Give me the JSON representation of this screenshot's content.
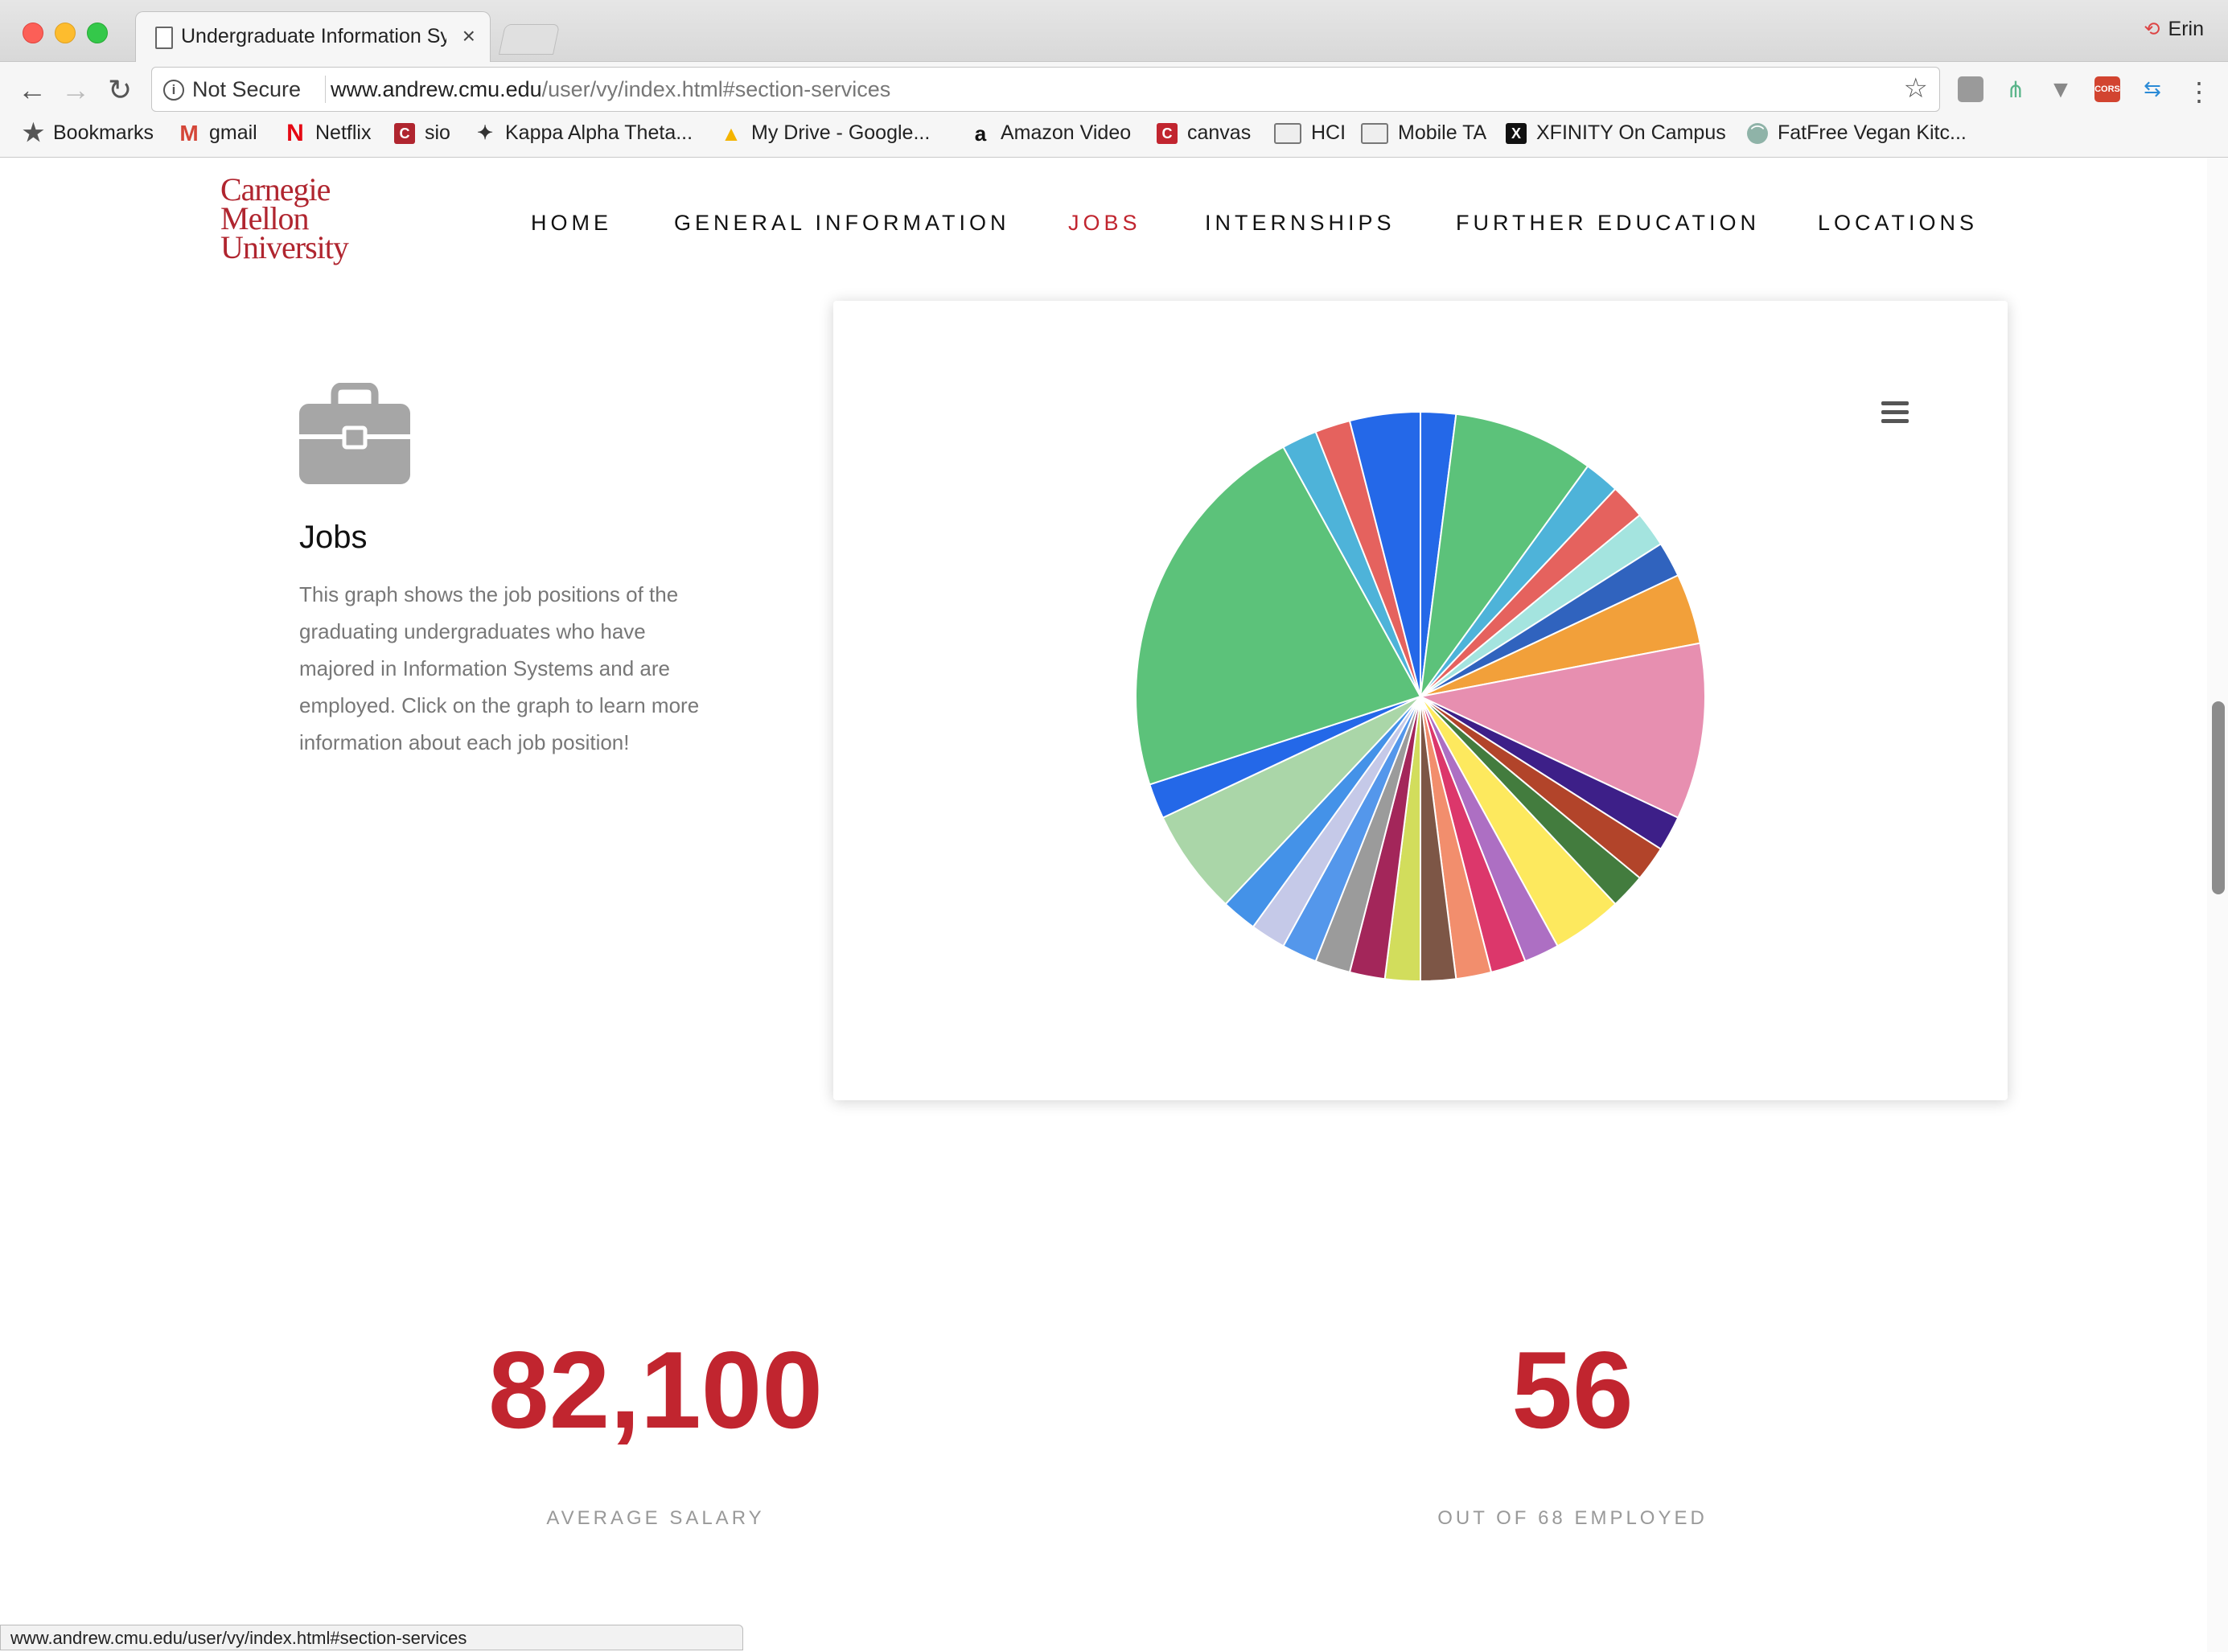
{
  "browser": {
    "tab_title": "Undergraduate Information Sys",
    "tab_close": "×",
    "profile_name": "Erin",
    "security_label": "Not Secure",
    "url_host": "www.andrew.cmu.edu",
    "url_path": "/user/vy/index.html#section-services",
    "bookmarks": [
      {
        "label": "Bookmarks",
        "icon": "star-icon"
      },
      {
        "label": "gmail",
        "icon": "gmail-icon"
      },
      {
        "label": "Netflix",
        "icon": "netflix-icon"
      },
      {
        "label": "sio",
        "icon": "cmu-icon"
      },
      {
        "label": "Kappa Alpha Theta...",
        "icon": "kite-icon"
      },
      {
        "label": "My Drive - Google...",
        "icon": "drive-icon"
      },
      {
        "label": "Amazon Video",
        "icon": "amazon-icon"
      },
      {
        "label": "canvas",
        "icon": "canvas-icon"
      },
      {
        "label": "HCI",
        "icon": "folder-icon"
      },
      {
        "label": "Mobile TA",
        "icon": "folder-icon"
      },
      {
        "label": "XFINITY On Campus",
        "icon": "xfinity-icon"
      },
      {
        "label": "FatFree Vegan Kitc...",
        "icon": "fatfree-icon"
      }
    ],
    "status_url": "www.andrew.cmu.edu/user/vy/index.html#section-services"
  },
  "site": {
    "logo_line1": "Carnegie",
    "logo_line2": "Mellon",
    "logo_line3": "University",
    "nav": [
      "HOME",
      "GENERAL INFORMATION",
      "JOBS",
      "INTERNSHIPS",
      "FURTHER EDUCATION",
      "LOCATIONS"
    ],
    "active_nav": "JOBS",
    "accent_color": "#c1252f"
  },
  "jobs": {
    "heading": "Jobs",
    "description": "This graph shows the job positions of the graduating undergraduates who have majored in Information Systems and are employed. Click on the graph to learn more information about each job position!"
  },
  "chart_data": {
    "type": "pie",
    "values": [
      1,
      4,
      1,
      1,
      1,
      1,
      2,
      5,
      1,
      1,
      1,
      2,
      1,
      1,
      1,
      1,
      1,
      1,
      1,
      1,
      1,
      1,
      3,
      1,
      11,
      1,
      1,
      2
    ],
    "colors": [
      "#2468e8",
      "#5cc27a",
      "#4eb3d9",
      "#e5625e",
      "#a4e4df",
      "#3063be",
      "#f2a03a",
      "#e78fb0",
      "#3d1f88",
      "#b2442a",
      "#437c3e",
      "#fde95e",
      "#ad6fc3",
      "#dc376b",
      "#f28e6d",
      "#7d5646",
      "#d2dd5c",
      "#a3265a",
      "#9b9b9b",
      "#5497eb",
      "#c5c9e8",
      "#4492e8",
      "#aad6a8",
      "#2468e8",
      "#5cc27a",
      "#4eb3d9",
      "#e5625e"
    ]
  },
  "stats": [
    {
      "value": "82,100",
      "label": "AVERAGE SALARY"
    },
    {
      "value": "56",
      "label": "OUT OF 68 EMPLOYED"
    }
  ]
}
